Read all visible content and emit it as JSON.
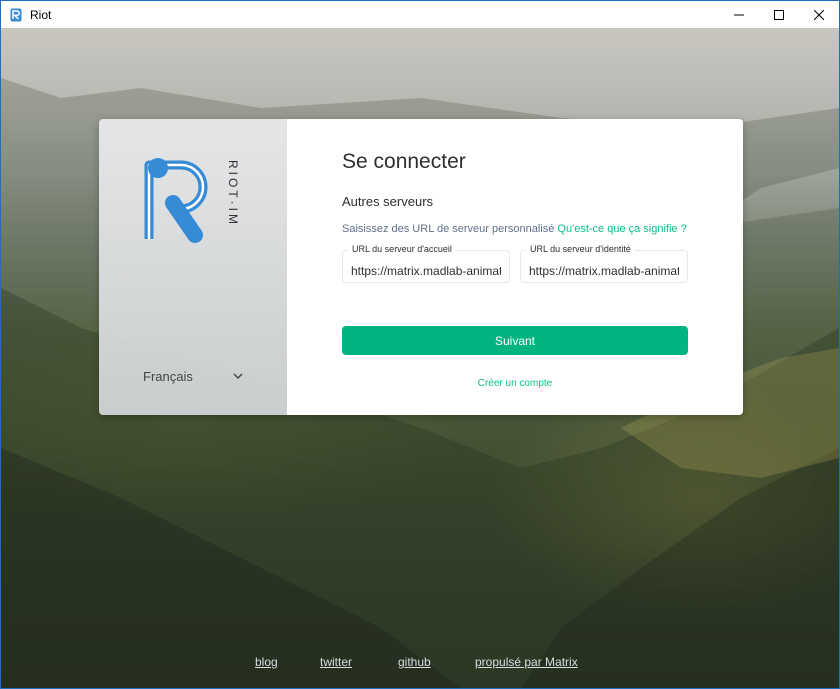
{
  "window": {
    "title": "Riot",
    "app_icon": "riot-app-icon",
    "controls": [
      "minimize-icon",
      "maximize-icon",
      "close-icon"
    ]
  },
  "auth": {
    "logo_text": "RIOT·IM",
    "language": "Français",
    "title": "Se connecter",
    "section_title": "Autres serveurs",
    "help_text": "Saisissez des URL de serveur personnalisé ",
    "help_link": "Qu'est-ce que ça signifie ?",
    "homeserver": {
      "label": "URL du serveur d'accueil",
      "value": "https://matrix.madlab-animation.fr"
    },
    "identity_server": {
      "label": "URL du serveur d'identité",
      "value": "https://matrix.madlab-animation.fr"
    },
    "next_label": "Suivant",
    "create_account": "Créer un compte"
  },
  "footer": {
    "links": [
      "blog",
      "twitter",
      "github",
      "propulsé par Matrix"
    ]
  },
  "colors": {
    "accent": "#03b381",
    "link": "#0dbd8b",
    "logo_blue": "#368bd6",
    "window_border": "#1f6fbf"
  }
}
